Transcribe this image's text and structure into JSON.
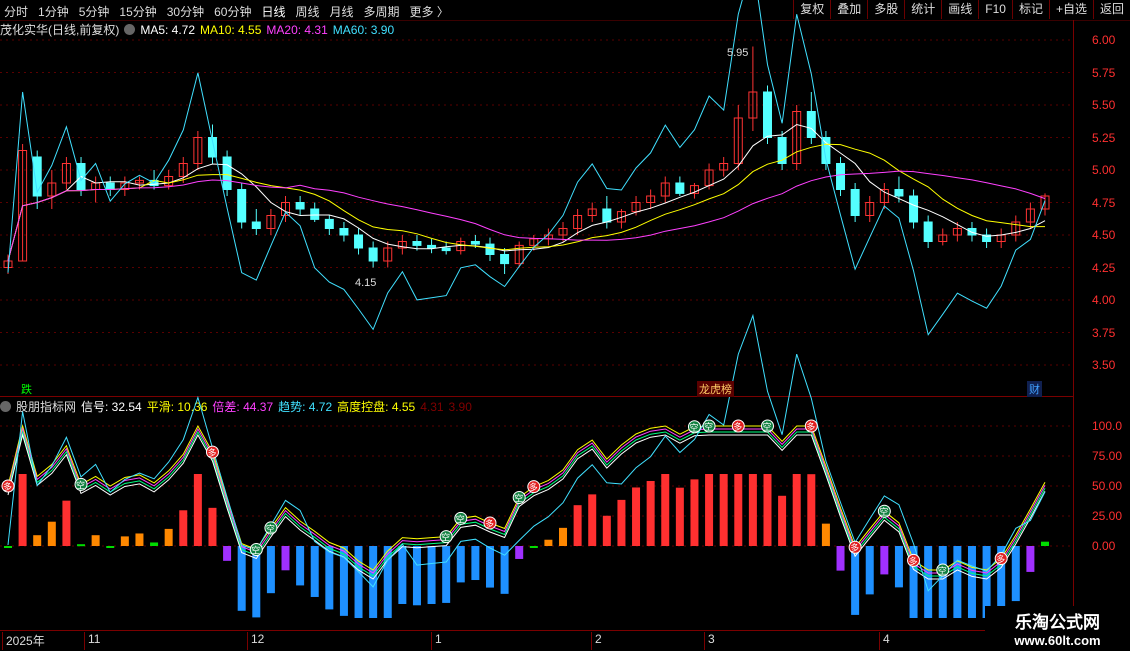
{
  "toolbar": {
    "periods": [
      "分时",
      "1分钟",
      "5分钟",
      "15分钟",
      "30分钟",
      "60分钟",
      "日线",
      "周线",
      "月线",
      "多周期",
      "更多 〉"
    ],
    "active_period": "日线",
    "right_buttons": [
      "复权",
      "叠加",
      "多股",
      "统计",
      "画线",
      "F10",
      "标记",
      "+自选",
      "返回"
    ]
  },
  "main_chart": {
    "title": "茂化实华(日线,前复权)",
    "ma": [
      {
        "label": "MA5: 4.72",
        "color": "#ffffff"
      },
      {
        "label": "MA10: 4.55",
        "color": "#ffff00"
      },
      {
        "label": "MA20: 4.31",
        "color": "#ff40ff"
      },
      {
        "label": "MA60: 3.90",
        "color": "#40e0ff"
      }
    ],
    "high_label": "5.95",
    "low_label": "4.15",
    "yticks": [
      "6.00",
      "5.75",
      "5.50",
      "5.25",
      "5.00",
      "4.75",
      "4.50",
      "4.25",
      "4.00",
      "3.75",
      "3.50"
    ],
    "markers": [
      {
        "text": "跌",
        "color": "#00ff00"
      },
      {
        "text": "龙虎榜",
        "color": "#ffcc66"
      },
      {
        "text": "财",
        "color": "#40a0ff"
      }
    ]
  },
  "sub_chart": {
    "title": "股朋指标网",
    "indicators": [
      {
        "label": "信号: 32.54",
        "color": "#ffffff"
      },
      {
        "label": "平滑: 10.36",
        "color": "#ffff00"
      },
      {
        "label": "倍差: 44.37",
        "color": "#ff40ff"
      },
      {
        "label": "趋势: 4.72",
        "color": "#40e0ff"
      },
      {
        "label": "高度控盘: 4.55",
        "color": "#ffff00"
      },
      {
        "label": "4.31",
        "color": "#800000"
      },
      {
        "label": "3.90",
        "color": "#800000"
      }
    ],
    "yticks": [
      "100.0",
      "75.00",
      "50.00",
      "25.00",
      "0.00"
    ],
    "signal_sell": "多",
    "signal_buy": "空"
  },
  "x_axis": {
    "labels": [
      "2025年",
      "11",
      "12",
      "1",
      "2",
      "3",
      "4"
    ]
  },
  "watermark": {
    "line1": "乐淘公式网",
    "line2": "www.60lt.com"
  },
  "colors": {
    "up": "#ff3333",
    "down": "#54ffff",
    "grid": "#7a0000",
    "axis_text": "#ff3030"
  },
  "chart_data": {
    "type": "candlestick",
    "ylim": [
      3.4,
      6.05
    ],
    "candles": [
      [
        4.25,
        4.35,
        4.2,
        4.3
      ],
      [
        4.3,
        5.2,
        4.3,
        5.15
      ],
      [
        5.1,
        5.15,
        4.7,
        4.8
      ],
      [
        4.8,
        5.0,
        4.7,
        4.9
      ],
      [
        4.9,
        5.1,
        4.85,
        5.05
      ],
      [
        5.05,
        5.1,
        4.8,
        4.85
      ],
      [
        4.85,
        4.95,
        4.75,
        4.9
      ],
      [
        4.9,
        4.95,
        4.8,
        4.85
      ],
      [
        4.85,
        4.95,
        4.8,
        4.9
      ],
      [
        4.9,
        4.95,
        4.85,
        4.92
      ],
      [
        4.92,
        5.0,
        4.85,
        4.88
      ],
      [
        4.88,
        5.0,
        4.85,
        4.95
      ],
      [
        4.95,
        5.1,
        4.9,
        5.05
      ],
      [
        5.05,
        5.3,
        5.0,
        5.25
      ],
      [
        5.25,
        5.35,
        5.05,
        5.1
      ],
      [
        5.1,
        5.15,
        4.8,
        4.85
      ],
      [
        4.85,
        4.9,
        4.55,
        4.6
      ],
      [
        4.6,
        4.7,
        4.5,
        4.55
      ],
      [
        4.55,
        4.7,
        4.5,
        4.65
      ],
      [
        4.65,
        4.8,
        4.6,
        4.75
      ],
      [
        4.75,
        4.8,
        4.65,
        4.7
      ],
      [
        4.7,
        4.75,
        4.6,
        4.62
      ],
      [
        4.62,
        4.65,
        4.5,
        4.55
      ],
      [
        4.55,
        4.6,
        4.45,
        4.5
      ],
      [
        4.5,
        4.55,
        4.35,
        4.4
      ],
      [
        4.4,
        4.45,
        4.25,
        4.3
      ],
      [
        4.3,
        4.45,
        4.25,
        4.4
      ],
      [
        4.4,
        4.5,
        4.35,
        4.45
      ],
      [
        4.45,
        4.5,
        4.38,
        4.42
      ],
      [
        4.42,
        4.47,
        4.36,
        4.4
      ],
      [
        4.4,
        4.45,
        4.35,
        4.38
      ],
      [
        4.38,
        4.48,
        4.35,
        4.45
      ],
      [
        4.45,
        4.5,
        4.4,
        4.43
      ],
      [
        4.43,
        4.48,
        4.3,
        4.35
      ],
      [
        4.35,
        4.4,
        4.2,
        4.28
      ],
      [
        4.28,
        4.45,
        4.25,
        4.42
      ],
      [
        4.42,
        4.5,
        4.38,
        4.47
      ],
      [
        4.47,
        4.55,
        4.42,
        4.5
      ],
      [
        4.5,
        4.6,
        4.45,
        4.55
      ],
      [
        4.55,
        4.7,
        4.5,
        4.65
      ],
      [
        4.65,
        4.75,
        4.6,
        4.7
      ],
      [
        4.7,
        4.8,
        4.55,
        4.6
      ],
      [
        4.6,
        4.7,
        4.55,
        4.68
      ],
      [
        4.68,
        4.8,
        4.65,
        4.75
      ],
      [
        4.75,
        4.85,
        4.7,
        4.8
      ],
      [
        4.8,
        4.95,
        4.75,
        4.9
      ],
      [
        4.9,
        4.95,
        4.8,
        4.82
      ],
      [
        4.82,
        4.9,
        4.78,
        4.88
      ],
      [
        4.88,
        5.05,
        4.85,
        5.0
      ],
      [
        5.0,
        5.1,
        4.95,
        5.05
      ],
      [
        5.05,
        5.5,
        5.0,
        5.4
      ],
      [
        5.4,
        5.95,
        5.3,
        5.6
      ],
      [
        5.6,
        5.65,
        5.2,
        5.25
      ],
      [
        5.25,
        5.3,
        5.0,
        5.05
      ],
      [
        5.05,
        5.5,
        5.0,
        5.45
      ],
      [
        5.45,
        5.6,
        5.2,
        5.25
      ],
      [
        5.25,
        5.3,
        5.0,
        5.05
      ],
      [
        5.05,
        5.1,
        4.8,
        4.85
      ],
      [
        4.85,
        4.9,
        4.6,
        4.65
      ],
      [
        4.65,
        4.8,
        4.6,
        4.75
      ],
      [
        4.75,
        4.9,
        4.7,
        4.85
      ],
      [
        4.85,
        4.95,
        4.75,
        4.8
      ],
      [
        4.8,
        4.85,
        4.55,
        4.6
      ],
      [
        4.6,
        4.65,
        4.4,
        4.45
      ],
      [
        4.45,
        4.55,
        4.42,
        4.5
      ],
      [
        4.5,
        4.6,
        4.45,
        4.55
      ],
      [
        4.55,
        4.6,
        4.45,
        4.5
      ],
      [
        4.5,
        4.55,
        4.4,
        4.45
      ],
      [
        4.45,
        4.55,
        4.4,
        4.5
      ],
      [
        4.5,
        4.65,
        4.45,
        4.6
      ],
      [
        4.6,
        4.75,
        4.55,
        4.7
      ],
      [
        4.7,
        4.82,
        4.65,
        4.8
      ]
    ]
  }
}
